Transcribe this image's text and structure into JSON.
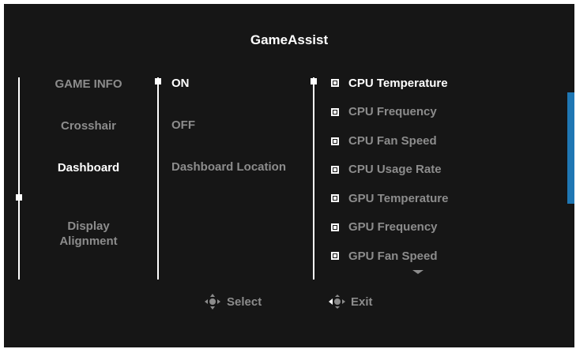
{
  "title": "GameAssist",
  "menu": [
    {
      "label": "GAME INFO",
      "active": false
    },
    {
      "label": "Crosshair",
      "active": false
    },
    {
      "label": "Dashboard",
      "active": true
    },
    {
      "label": "Display\nAlignment",
      "active": false
    }
  ],
  "options": [
    {
      "label": "ON",
      "active": true
    },
    {
      "label": "OFF",
      "active": false
    },
    {
      "label": "Dashboard Location",
      "active": false
    }
  ],
  "metrics": [
    {
      "label": "CPU Temperature",
      "active": true
    },
    {
      "label": "CPU Frequency",
      "active": false
    },
    {
      "label": "CPU Fan Speed",
      "active": false
    },
    {
      "label": "CPU Usage Rate",
      "active": false
    },
    {
      "label": "GPU Temperature",
      "active": false
    },
    {
      "label": "GPU Frequency",
      "active": false
    },
    {
      "label": "GPU Fan Speed",
      "active": false
    }
  ],
  "hints": {
    "select_label": "Select",
    "exit_label": "Exit",
    "select_icon": "joystick-icon",
    "exit_icon": "joystick-left-icon"
  },
  "colors": {
    "background": "#161616",
    "active_text": "#ffffff",
    "inactive_text": "#8c8c8c",
    "scrollbar": "#1f77b4"
  }
}
